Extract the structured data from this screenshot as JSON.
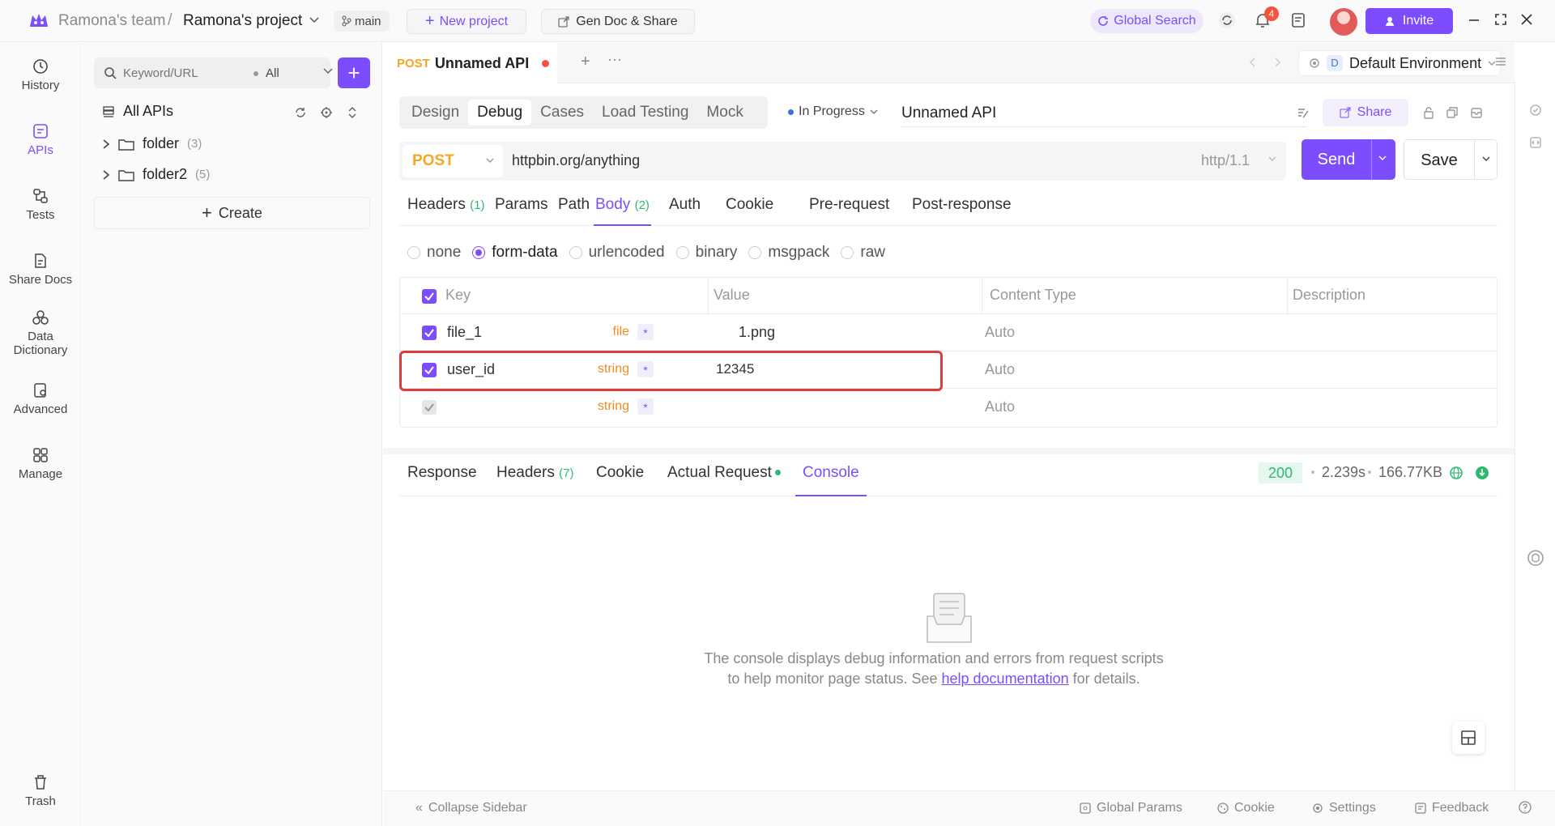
{
  "topbar": {
    "team": "Ramona's team",
    "separator": "/",
    "project": "Ramona's project",
    "branch": "main",
    "new_project": "New project",
    "gen_doc": "Gen Doc & Share",
    "global_search": "Global Search",
    "notifications": "4",
    "invite": "Invite"
  },
  "nav": {
    "items": [
      {
        "label": "History",
        "icon": "history-icon"
      },
      {
        "label": "APIs",
        "icon": "apis-icon"
      },
      {
        "label": "Tests",
        "icon": "tests-icon"
      },
      {
        "label": "Share Docs",
        "icon": "share-docs-icon"
      },
      {
        "label": "Data Dictionary",
        "icon": "data-dictionary-icon"
      },
      {
        "label": "Advanced",
        "icon": "advanced-icon"
      },
      {
        "label": "Manage",
        "icon": "manage-icon"
      }
    ],
    "trash": "Trash"
  },
  "sidebar": {
    "search_placeholder": "Keyword/URL",
    "filter": "All",
    "all_apis": "All APIs",
    "folders": [
      {
        "name": "folder",
        "count": "(3)"
      },
      {
        "name": "folder2",
        "count": "(5)"
      }
    ],
    "create": "Create"
  },
  "tab": {
    "method": "POST",
    "title": "Unnamed API"
  },
  "environment": {
    "badge": "D",
    "name": "Default Environment"
  },
  "mode_tabs": [
    "Design",
    "Debug",
    "Cases",
    "Load Testing",
    "Mock"
  ],
  "status": "In Progress",
  "api_name": "Unnamed API",
  "share": "Share",
  "request": {
    "method": "POST",
    "url": "httpbin.org/anything",
    "protocol": "http/1.1",
    "send": "Send",
    "save": "Save"
  },
  "request_tabs": {
    "headers": "Headers",
    "headers_count": "(1)",
    "params": "Params",
    "path": "Path",
    "body": "Body",
    "body_count": "(2)",
    "auth": "Auth",
    "cookie": "Cookie",
    "pre": "Pre-request",
    "post": "Post-response"
  },
  "body_types": [
    "none",
    "form-data",
    "urlencoded",
    "binary",
    "msgpack",
    "raw"
  ],
  "params_table": {
    "headers": {
      "key": "Key",
      "value": "Value",
      "content_type": "Content Type",
      "description": "Description"
    },
    "rows": [
      {
        "key": "file_1",
        "type": "file",
        "required": "*",
        "value": "1.png",
        "content_type": "Auto"
      },
      {
        "key": "user_id",
        "type": "string",
        "required": "*",
        "value": "12345",
        "content_type": "Auto"
      },
      {
        "key": "",
        "type": "string",
        "required": "*",
        "value": "",
        "content_type": "Auto"
      }
    ]
  },
  "response": {
    "tabs": {
      "response": "Response",
      "headers": "Headers",
      "headers_count": "(7)",
      "cookie": "Cookie",
      "actual": "Actual Request",
      "console": "Console"
    },
    "status_code": "200",
    "time": "2.239s",
    "size": "166.77KB",
    "console_text_1": "The console displays debug information and errors from request scripts",
    "console_text_2a": "to help monitor page status. See ",
    "console_link": "help documentation",
    "console_text_2b": " for details."
  },
  "statusbar": {
    "collapse": "Collapse Sidebar",
    "global_params": "Global Params",
    "cookie": "Cookie",
    "settings": "Settings",
    "feedback": "Feedback"
  },
  "colors": {
    "accent": "#7c4dff",
    "post": "#f5a623",
    "success": "#2eb872",
    "highlight": "#e03b3b"
  }
}
